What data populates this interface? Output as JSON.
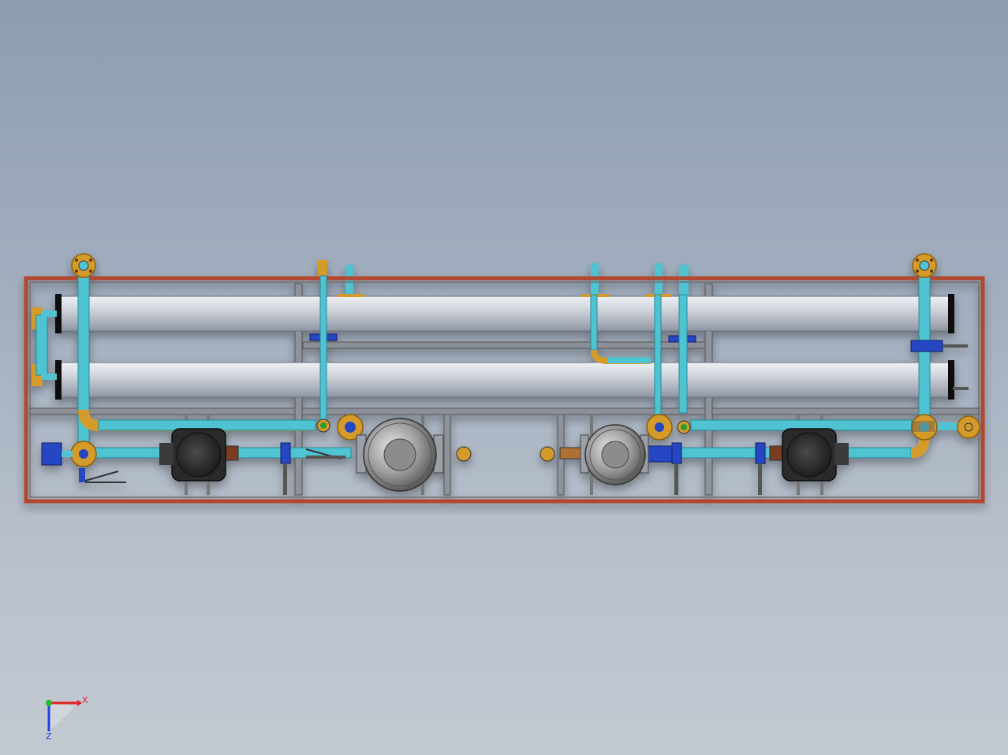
{
  "view": {
    "colors": {
      "background_top": "#8d9db2",
      "background_bottom": "#c3c9d1",
      "frame": "#b5462f",
      "vessel": "#c8ccd3",
      "pipe": "#4fc3d1",
      "flange": "#d49a2a",
      "valve": "#2747c4",
      "motor": "#2b2b2b",
      "tank": "#9a9a9a"
    },
    "icons": {
      "triad": "coordinate-triad-icon"
    }
  },
  "triad": {
    "x_label": "X",
    "z_label": "Z",
    "x_color": "#e02020",
    "y_color": "#20c020",
    "z_color": "#2040e0"
  }
}
